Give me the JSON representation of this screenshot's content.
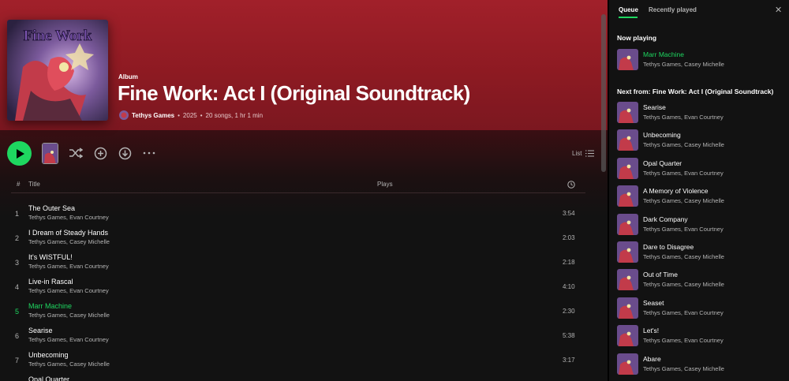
{
  "album": {
    "type_label": "Album",
    "title": "Fine Work: Act I (Original Soundtrack)",
    "artist": "Tethys Games",
    "year": "2025",
    "summary": "20 songs, 1 hr 1 min",
    "cover_text": "Fine Work"
  },
  "actions": {
    "view_mode_label": "List"
  },
  "table": {
    "col_number": "#",
    "col_title": "Title",
    "col_plays": "Plays",
    "tracks": [
      {
        "n": "1",
        "title": "The Outer Sea",
        "artists": "Tethys Games, Evan Courtney",
        "duration": "3:54"
      },
      {
        "n": "2",
        "title": "I Dream of Steady Hands",
        "artists": "Tethys Games, Casey Michelle",
        "duration": "2:03"
      },
      {
        "n": "3",
        "title": "It's WISTFUL!",
        "artists": "Tethys Games, Evan Courtney",
        "duration": "2:18"
      },
      {
        "n": "4",
        "title": "Live-in Rascal",
        "artists": "Tethys Games, Evan Courtney",
        "duration": "4:10"
      },
      {
        "n": "5",
        "title": "Marr Machine",
        "artists": "Tethys Games, Casey Michelle",
        "duration": "2:30"
      },
      {
        "n": "6",
        "title": "Searise",
        "artists": "Tethys Games, Evan Courtney",
        "duration": "5:38"
      },
      {
        "n": "7",
        "title": "Unbecoming",
        "artists": "Tethys Games, Casey Michelle",
        "duration": "3:17"
      },
      {
        "n": "8",
        "title": "Opal Quarter",
        "artists": "",
        "duration": ""
      }
    ]
  },
  "queue": {
    "tab_queue": "Queue",
    "tab_recent": "Recently played",
    "close_symbol": "✕",
    "now_playing_heading": "Now playing",
    "now_playing": {
      "title": "Marr Machine",
      "artists": "Tethys Games, Casey Michelle"
    },
    "next_heading": "Next from: Fine Work: Act I (Original Soundtrack)",
    "next": [
      {
        "title": "Searise",
        "artists": "Tethys Games, Evan Courtney"
      },
      {
        "title": "Unbecoming",
        "artists": "Tethys Games, Casey Michelle"
      },
      {
        "title": "Opal Quarter",
        "artists": "Tethys Games, Evan Courtney"
      },
      {
        "title": "A Memory of Violence",
        "artists": "Tethys Games, Casey Michelle"
      },
      {
        "title": "Dark Company",
        "artists": "Tethys Games, Evan Courtney"
      },
      {
        "title": "Dare to Disagree",
        "artists": "Tethys Games, Casey Michelle"
      },
      {
        "title": "Out of Time",
        "artists": "Tethys Games, Casey Michelle"
      },
      {
        "title": "Seaset",
        "artists": "Tethys Games, Evan Courtney"
      },
      {
        "title": "Let's!",
        "artists": "Tethys Games, Evan Courtney"
      },
      {
        "title": "Abare",
        "artists": "Tethys Games, Casey Michelle"
      }
    ]
  },
  "colors": {
    "accent": "#1ed760",
    "hero": "#a1202a"
  },
  "playing_track_index": 4
}
